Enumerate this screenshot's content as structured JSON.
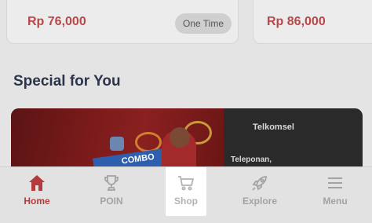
{
  "cards": [
    {
      "price": "Rp 76,000",
      "badge": "One Time"
    },
    {
      "price": "Rp 86,000"
    }
  ],
  "section_title": "Special for You",
  "banner": {
    "art_text": "COMBO",
    "brand": "Telkomsel",
    "promo_text": "Teleponan,"
  },
  "bottom_nav": {
    "items": [
      {
        "label": "Home",
        "icon": "home-icon",
        "state": "active"
      },
      {
        "label": "POIN",
        "icon": "trophy-icon",
        "state": "inactive"
      },
      {
        "label": "Shop",
        "icon": "cart-icon",
        "state": "highlighted"
      },
      {
        "label": "Explore",
        "icon": "rocket-icon",
        "state": "inactive"
      },
      {
        "label": "Menu",
        "icon": "hamburger-icon",
        "state": "inactive"
      }
    ]
  },
  "colors": {
    "accent": "#b53a3d",
    "price": "#b8474a",
    "title": "#2b3448",
    "inactive": "#a3a3a3"
  }
}
